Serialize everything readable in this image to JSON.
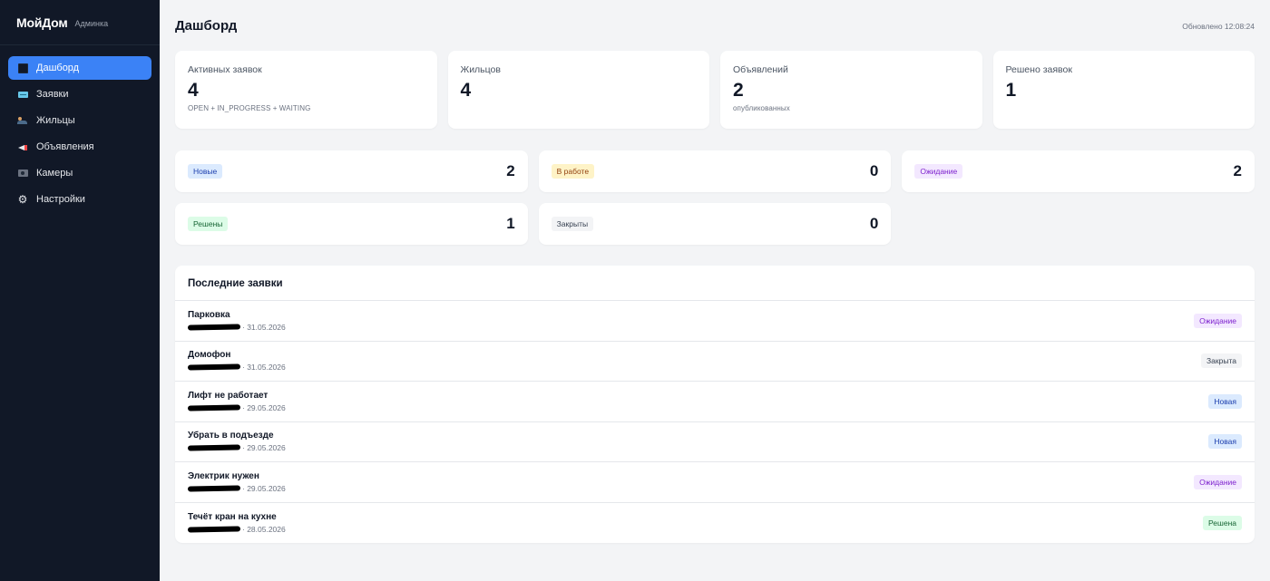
{
  "brand": {
    "name": "МойДом",
    "subtitle": "Админка"
  },
  "sidebar": {
    "items": [
      {
        "label": "Дашборд",
        "icon": "dashboard-icon",
        "active": true
      },
      {
        "label": "Заявки",
        "icon": "ticket-icon"
      },
      {
        "label": "Жильцы",
        "icon": "residents-icon"
      },
      {
        "label": "Объявления",
        "icon": "megaphone-icon"
      },
      {
        "label": "Камеры",
        "icon": "camera-icon"
      },
      {
        "label": "Настройки",
        "icon": "gear-icon"
      }
    ]
  },
  "header": {
    "title": "Дашборд",
    "updated": "Обновлено 12:08:24"
  },
  "stats": [
    {
      "label": "Активных заявок",
      "value": "4",
      "sub": "OPEN + IN_PROGRESS + WAITING"
    },
    {
      "label": "Жильцов",
      "value": "4",
      "sub": ""
    },
    {
      "label": "Объявлений",
      "value": "2",
      "sub": "опубликованных"
    },
    {
      "label": "Решено заявок",
      "value": "1",
      "sub": ""
    }
  ],
  "statuses": [
    {
      "label": "Новые",
      "count": "2",
      "color": "#dbeafe"
    },
    {
      "label": "В работе",
      "count": "0",
      "color": "#fef3c7"
    },
    {
      "label": "Ожидание",
      "count": "2",
      "color": "#f3e8ff"
    },
    {
      "label": "Решены",
      "count": "1",
      "color": "#dcfce7"
    },
    {
      "label": "Закрыты",
      "count": "0",
      "color": "#f3f4f6"
    }
  ],
  "recent": {
    "title": "Последние заявки",
    "rows": [
      {
        "title": "Парковка",
        "date": "· 31.05.2026",
        "status": "Ожидание"
      },
      {
        "title": "Домофон",
        "date": "· 31.05.2026",
        "status": "Закрыта"
      },
      {
        "title": "Лифт не работает",
        "date": "· 29.05.2026",
        "status": "Новая"
      },
      {
        "title": "Убрать в подъезде",
        "date": "· 29.05.2026",
        "status": "Новая"
      },
      {
        "title": "Электрик нужен",
        "date": "· 29.05.2026",
        "status": "Ожидание"
      },
      {
        "title": "Течёт кран на кухне",
        "date": "· 28.05.2026",
        "status": "Решена"
      }
    ]
  },
  "colors": {
    "sidebar_bg": "#111827",
    "accent": "#3b82f6",
    "page_bg": "#f3f4f6"
  }
}
